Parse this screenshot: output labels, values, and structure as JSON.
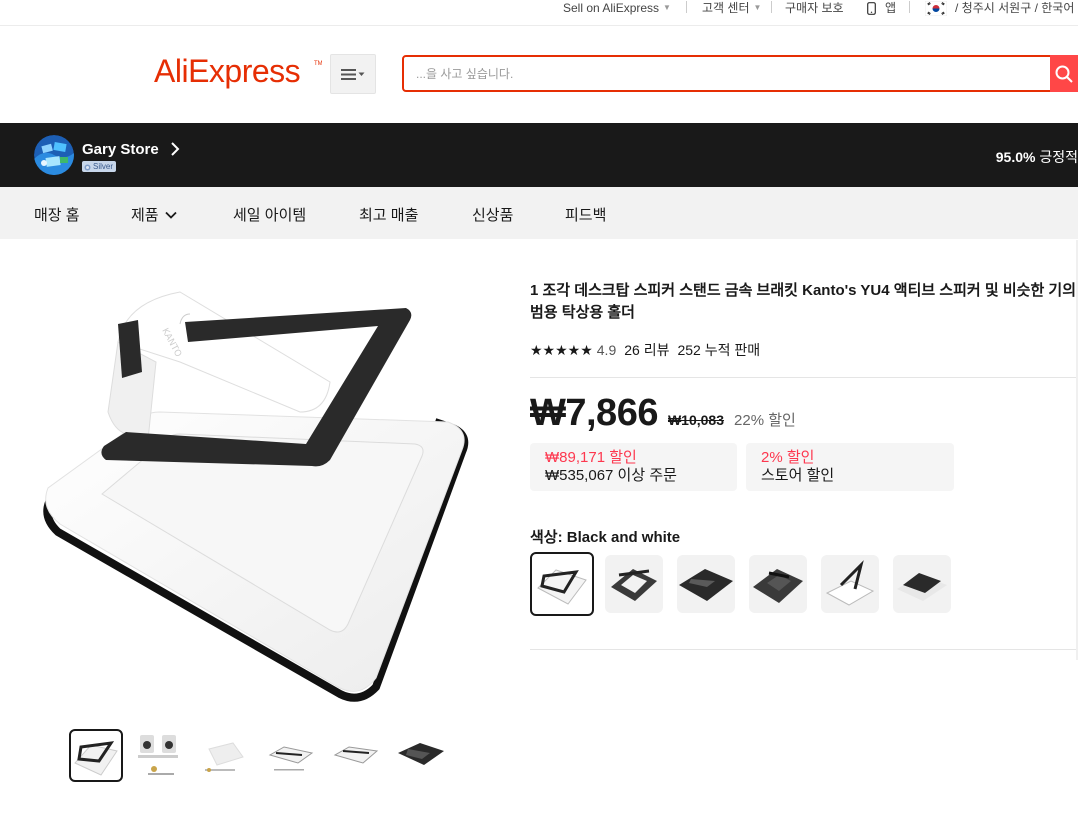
{
  "topbar": {
    "sell": "Sell on AliExpress",
    "support": "고객 센터",
    "buyer_protection": "구매자 보호",
    "app": "앱",
    "location": "/ 청주시 서원구 / 한국어"
  },
  "header": {
    "logo": "AliExpress",
    "search_placeholder": "...을 사고 싶습니다."
  },
  "store": {
    "name": "Gary Store",
    "badge": "Silver",
    "feedback_value": "95.0%",
    "feedback_label": "긍정적"
  },
  "store_nav": [
    "매장 홈",
    "제품",
    "세일 아이템",
    "최고 매출",
    "신상품",
    "피드백"
  ],
  "product": {
    "title": "1 조각 데스크탑 스피커 스탠드 금속 브래킷 Kanto's YU4 액티브 스피커 및 비슷한 기의 범용 탁상용 홀더",
    "stars": "★★★★★",
    "rating": "4.9",
    "reviews": "26 리뷰",
    "sold": "252 누적 판매",
    "price": "₩7,866",
    "original_price": "₩10,083",
    "discount": "22% 할인",
    "coupons": [
      {
        "title": "₩89,171 할인",
        "subtitle": "₩535,067 이상 주문"
      },
      {
        "title": "2% 할인",
        "subtitle": "스토어 할인"
      }
    ],
    "color_label": "색상:",
    "color_value": "Black and white",
    "rating_value": 4.9
  },
  "icons": {
    "menu": "hamburger-menu-icon",
    "search": "search-icon",
    "phone": "phone-icon",
    "flag": "korea-flag-icon",
    "chevron": "chevron-right-icon"
  },
  "colors": {
    "brand": "#e62e04",
    "search_button": "#ff4747",
    "store_bar": "#191919",
    "coupon_red": "#fd384f"
  }
}
